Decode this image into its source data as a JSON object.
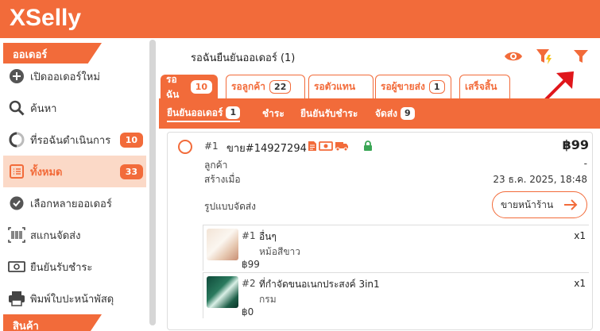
{
  "app": {
    "logo": "XSelly"
  },
  "sidebar": {
    "section_orders": "ออเดอร์",
    "section_products": "สินค้า",
    "items": [
      {
        "label": "เปิดออเดอร์ใหม่",
        "icon": "plus-circle-icon"
      },
      {
        "label": "ค้นหา",
        "icon": "search-icon"
      },
      {
        "label": "ที่รอฉันดำเนินการ",
        "icon": "progress-circle-icon",
        "badge": "10"
      },
      {
        "label": "ทั้งหมด",
        "icon": "list-icon",
        "badge": "33",
        "active": true
      },
      {
        "label": "เลือกหลายออเดอร์",
        "icon": "check-circle-icon"
      },
      {
        "label": "สแกนจัดส่ง",
        "icon": "barcode-icon"
      },
      {
        "label": "ยืนยันรับชำระ",
        "icon": "money-icon"
      },
      {
        "label": "พิมพ์ใบปะหน้าพัสดุ",
        "icon": "printer-icon"
      }
    ]
  },
  "header": {
    "title": "รอฉันยืนยันออเดอร์ (1)"
  },
  "tabs": [
    {
      "label": "รอฉัน",
      "count": "10",
      "active": true
    },
    {
      "label": "รอลูกค้า",
      "count": "22"
    },
    {
      "label": "รอตัวแทน",
      "count": ""
    },
    {
      "label": "รอผู้ขายส่ง",
      "count": "1"
    },
    {
      "label": "เสร็จสิ้น",
      "count": ""
    }
  ],
  "subtabs": [
    {
      "label": "ยืนยันออเดอร์",
      "count": "1",
      "active": true
    },
    {
      "label": "ชำระ",
      "count": ""
    },
    {
      "label": "ยืนยันรับชำระ",
      "count": ""
    },
    {
      "label": "จัดส่ง",
      "count": "9"
    }
  ],
  "order": {
    "num": "#1",
    "id": "ขาย#14927294",
    "total": "฿99",
    "customer_label": "ลูกค้า",
    "customer_value": "-",
    "created_label": "สร้างเมื่อ",
    "created_value": "23 ธ.ค. 2025, 18:48",
    "shipping_label": "รูปแบบจัดส่ง",
    "shipping_value": "ขายหน้าร้าน",
    "items": [
      {
        "num": "#1",
        "name": "อื่นๆ",
        "variant": "หม้อสีขาว",
        "price": "฿99",
        "qty": "x1"
      },
      {
        "num": "#2",
        "name": "ที่กำจัดขนอเนกประสงค์ 3in1",
        "variant": "กรม",
        "price": "฿0",
        "qty": "x1"
      }
    ]
  },
  "colors": {
    "accent": "#f26b3a",
    "active_bg": "#fbd9c7",
    "lock": "#3aa655",
    "annotation_arrow": "#e0161b"
  }
}
